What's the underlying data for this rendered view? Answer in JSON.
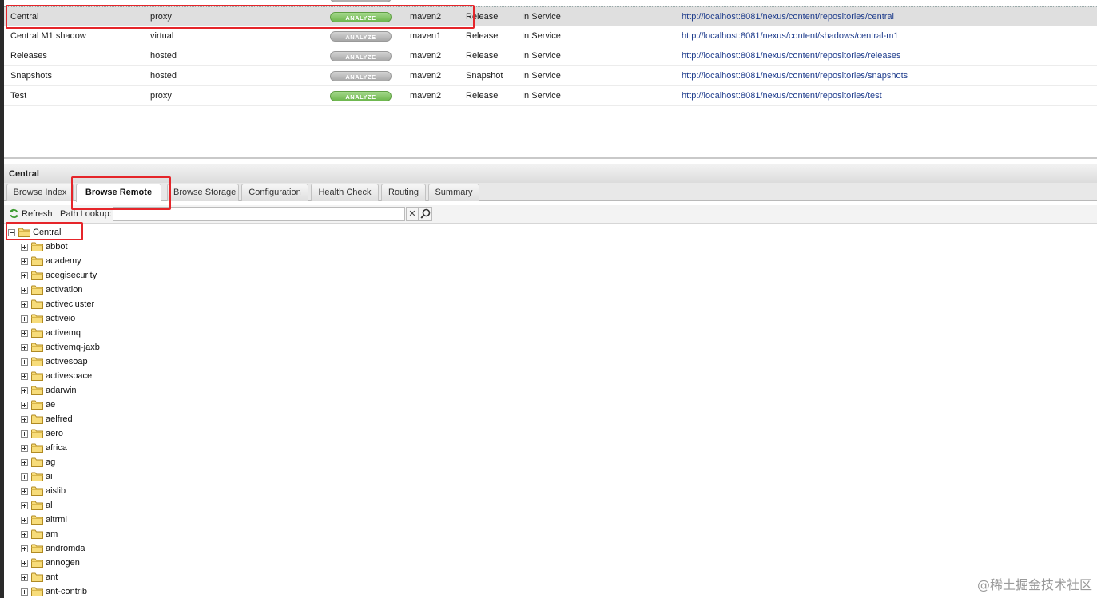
{
  "repositories": [
    {
      "name": "Central",
      "type": "proxy",
      "analyze": "ANALYZE",
      "analyze_state": "enabled",
      "format": "maven2",
      "policy": "Release",
      "status": "In Service",
      "url": "http://localhost:8081/nexus/content/repositories/central",
      "selected": true
    },
    {
      "name": "Central M1 shadow",
      "type": "virtual",
      "analyze": "ANALYZE",
      "analyze_state": "disabled",
      "format": "maven1",
      "policy": "Release",
      "status": "In Service",
      "url": "http://localhost:8081/nexus/content/shadows/central-m1"
    },
    {
      "name": "Releases",
      "type": "hosted",
      "analyze": "ANALYZE",
      "analyze_state": "disabled",
      "format": "maven2",
      "policy": "Release",
      "status": "In Service",
      "url": "http://localhost:8081/nexus/content/repositories/releases"
    },
    {
      "name": "Snapshots",
      "type": "hosted",
      "analyze": "ANALYZE",
      "analyze_state": "disabled",
      "format": "maven2",
      "policy": "Snapshot",
      "status": "In Service",
      "url": "http://localhost:8081/nexus/content/repositories/snapshots"
    },
    {
      "name": "Test",
      "type": "proxy",
      "analyze": "ANALYZE",
      "analyze_state": "enabled",
      "format": "maven2",
      "policy": "Release",
      "status": "In Service",
      "url": "http://localhost:8081/nexus/content/repositories/test"
    }
  ],
  "panel": {
    "title": "Central",
    "tabs": [
      "Browse Index",
      "Browse Remote",
      "Browse Storage",
      "Configuration",
      "Health Check",
      "Routing",
      "Summary"
    ],
    "active_tab": "Browse Remote"
  },
  "toolbar": {
    "refresh_label": "Refresh",
    "lookup_label": "Path Lookup:",
    "lookup_value": "",
    "clear_glyph": "✕"
  },
  "tree": {
    "root": "Central",
    "children": [
      "abbot",
      "academy",
      "acegisecurity",
      "activation",
      "activecluster",
      "activeio",
      "activemq",
      "activemq-jaxb",
      "activesoap",
      "activespace",
      "adarwin",
      "ae",
      "aelfred",
      "aero",
      "africa",
      "ag",
      "ai",
      "aislib",
      "al",
      "altrmi",
      "am",
      "andromda",
      "annogen",
      "ant",
      "ant-contrib"
    ]
  },
  "icons": {
    "refresh": "refresh-icon",
    "folder": "folder-icon",
    "search": "search-icon",
    "clear": "clear-icon"
  },
  "colors": {
    "highlight": "#e5252a",
    "analyze_enabled": "#6db64d",
    "analyze_disabled": "#a8a8a8",
    "link": "#1e3c8c",
    "folder": "#f2cf5b"
  },
  "watermark": "@稀土掘金技术社区"
}
